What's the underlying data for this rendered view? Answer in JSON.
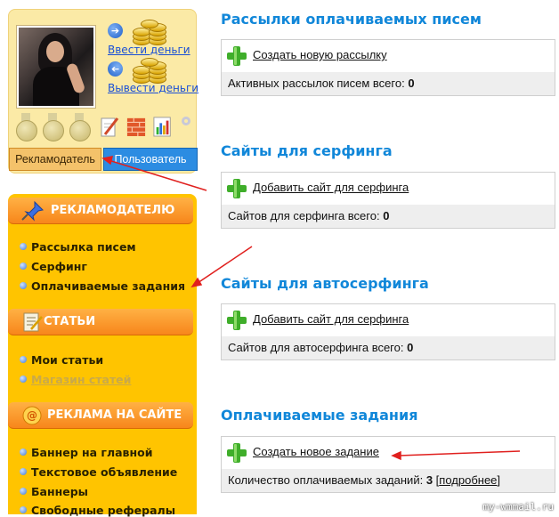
{
  "sidebar": {
    "deposit_label": "Ввести деньги",
    "withdraw_label": "Вывести деньги",
    "role_buttons": {
      "advertiser": "Рекламодатель",
      "user": "Пользователь"
    },
    "sections": [
      {
        "title": "РЕКЛАМОДАТЕЛЮ",
        "icon": "pushpin-icon",
        "items": [
          {
            "label": "Рассылка писем"
          },
          {
            "label": "Серфинг"
          },
          {
            "label": "Оплачиваемые задания"
          }
        ]
      },
      {
        "title": "СТАТЬИ",
        "icon": "article-icon",
        "items": [
          {
            "label": "Мои статьи"
          },
          {
            "label": "Магазин статей"
          }
        ]
      },
      {
        "title": "РЕКЛАМА НА САЙТЕ",
        "icon": "ad-icon",
        "items": [
          {
            "label": "Баннер на главной"
          },
          {
            "label": "Текстовое объявление"
          },
          {
            "label": "Баннеры"
          },
          {
            "label": "Свободные рефералы"
          }
        ]
      }
    ]
  },
  "main": {
    "sections": [
      {
        "title": "Рассылки оплачиваемых писем",
        "action": "Создать новую рассылку",
        "stat_label": "Активных рассылок писем всего:",
        "stat_value": "0"
      },
      {
        "title": "Сайты для серфинга",
        "action": "Добавить сайт для серфинга",
        "stat_label": "Сайтов для серфинга всего:",
        "stat_value": "0"
      },
      {
        "title": "Сайты для автосерфинга",
        "action": "Добавить сайт для серфинга",
        "stat_label": "Сайтов для автосерфинга всего:",
        "stat_value": "0"
      },
      {
        "title": "Оплачиваемые задания",
        "action": "Создать новое задание",
        "stat_label": "Количество оплачиваемых заданий:",
        "stat_value": "3",
        "more_label": "подробнее"
      }
    ]
  },
  "watermark": "my-wmmail.ru",
  "colors": {
    "accent_blue": "#1187d9",
    "menu_orange": "#f7861b",
    "menu_yellow": "#ffc400",
    "annotation_red": "#e0201e"
  }
}
